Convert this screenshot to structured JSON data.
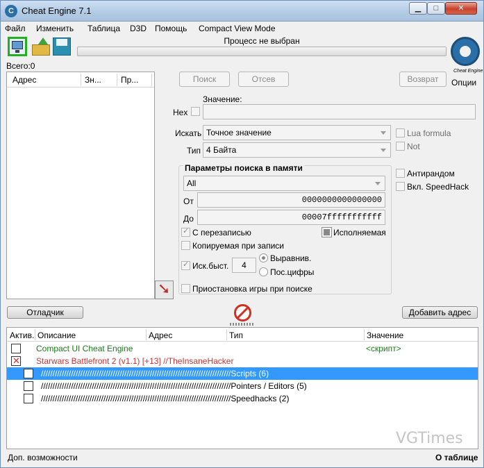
{
  "window": {
    "title": "Cheat Engine 7.1",
    "minimize": "▁",
    "maximize": "□",
    "close": "✕"
  },
  "menu": [
    "Файл",
    "Изменить",
    "Таблица",
    "D3D",
    "Помощь",
    "Compact View Mode"
  ],
  "toolbar": {
    "open_process_icon": "monitor-icon",
    "open_file_icon": "open-folder-icon",
    "save_icon": "floppy-icon"
  },
  "process": {
    "label": "Процесс не выбран"
  },
  "logo": {
    "caption": "Cheat Engine",
    "options": "Опции"
  },
  "found": {
    "label": "Всего:0",
    "columns": [
      "Адрес",
      "Зн...",
      "Пр..."
    ]
  },
  "scan": {
    "first_scan": "Поиск",
    "next_scan": "Отсев",
    "undo_scan": "Возврат",
    "value_label": "Значение:",
    "hex_label": "Hex",
    "value_input": "",
    "scan_type_label": "Искать",
    "scan_type_value": "Точное значение",
    "value_type_label": "Тип",
    "value_type_value": "4 Байта",
    "lua_formula": "Lua formula",
    "not": "Not",
    "antirandom": "Антирандом",
    "speedhack": "Вкл. SpeedHack"
  },
  "memory": {
    "title": "Параметры поиска в памяти",
    "region": "All",
    "from_label": "От",
    "from_value": "0000000000000000",
    "to_label": "До",
    "to_value": "00007fffffffffff",
    "writable": "С перезаписью",
    "executable": "Исполняемая",
    "copy_on_write": "Копируемая при записи",
    "fast_scan": "Иск.быст.",
    "fast_scan_value": "4",
    "alignment": "Выравнив.",
    "last_digits": "Пос.цифры",
    "pause_game": "Приостановка игры при поиске"
  },
  "actions": {
    "memory_view": "Отладчик",
    "add_address": "Добавить адрес"
  },
  "table": {
    "columns": [
      "Актив.",
      "Описание",
      "Адрес",
      "Тип",
      "Значение"
    ],
    "rows": [
      {
        "desc": "Compact UI Cheat Engine",
        "value": "<скрипт>",
        "color": "#1a7a1a",
        "checkbox": "empty"
      },
      {
        "desc": "Starwars Battlefront 2 (v1.1) [+13] //TheInsaneHacker",
        "value": "",
        "color": "#c83232",
        "checkbox": "x"
      },
      {
        "desc": "//////////////////////////////////////////////////////////////////////////////////Scripts (6)",
        "value": "",
        "color": "#ffffff",
        "checkbox": "empty"
      },
      {
        "desc": "//////////////////////////////////////////////////////////////////////////////////Pointers / Editors (5)",
        "value": "",
        "color": "#000000",
        "checkbox": "empty"
      },
      {
        "desc": "//////////////////////////////////////////////////////////////////////////////////Speedhacks (2)",
        "value": "",
        "color": "#000000",
        "checkbox": "empty"
      }
    ]
  },
  "status": {
    "advanced": "Доп. возможности",
    "table_info": "О таблице"
  },
  "watermark": "VGTimes"
}
